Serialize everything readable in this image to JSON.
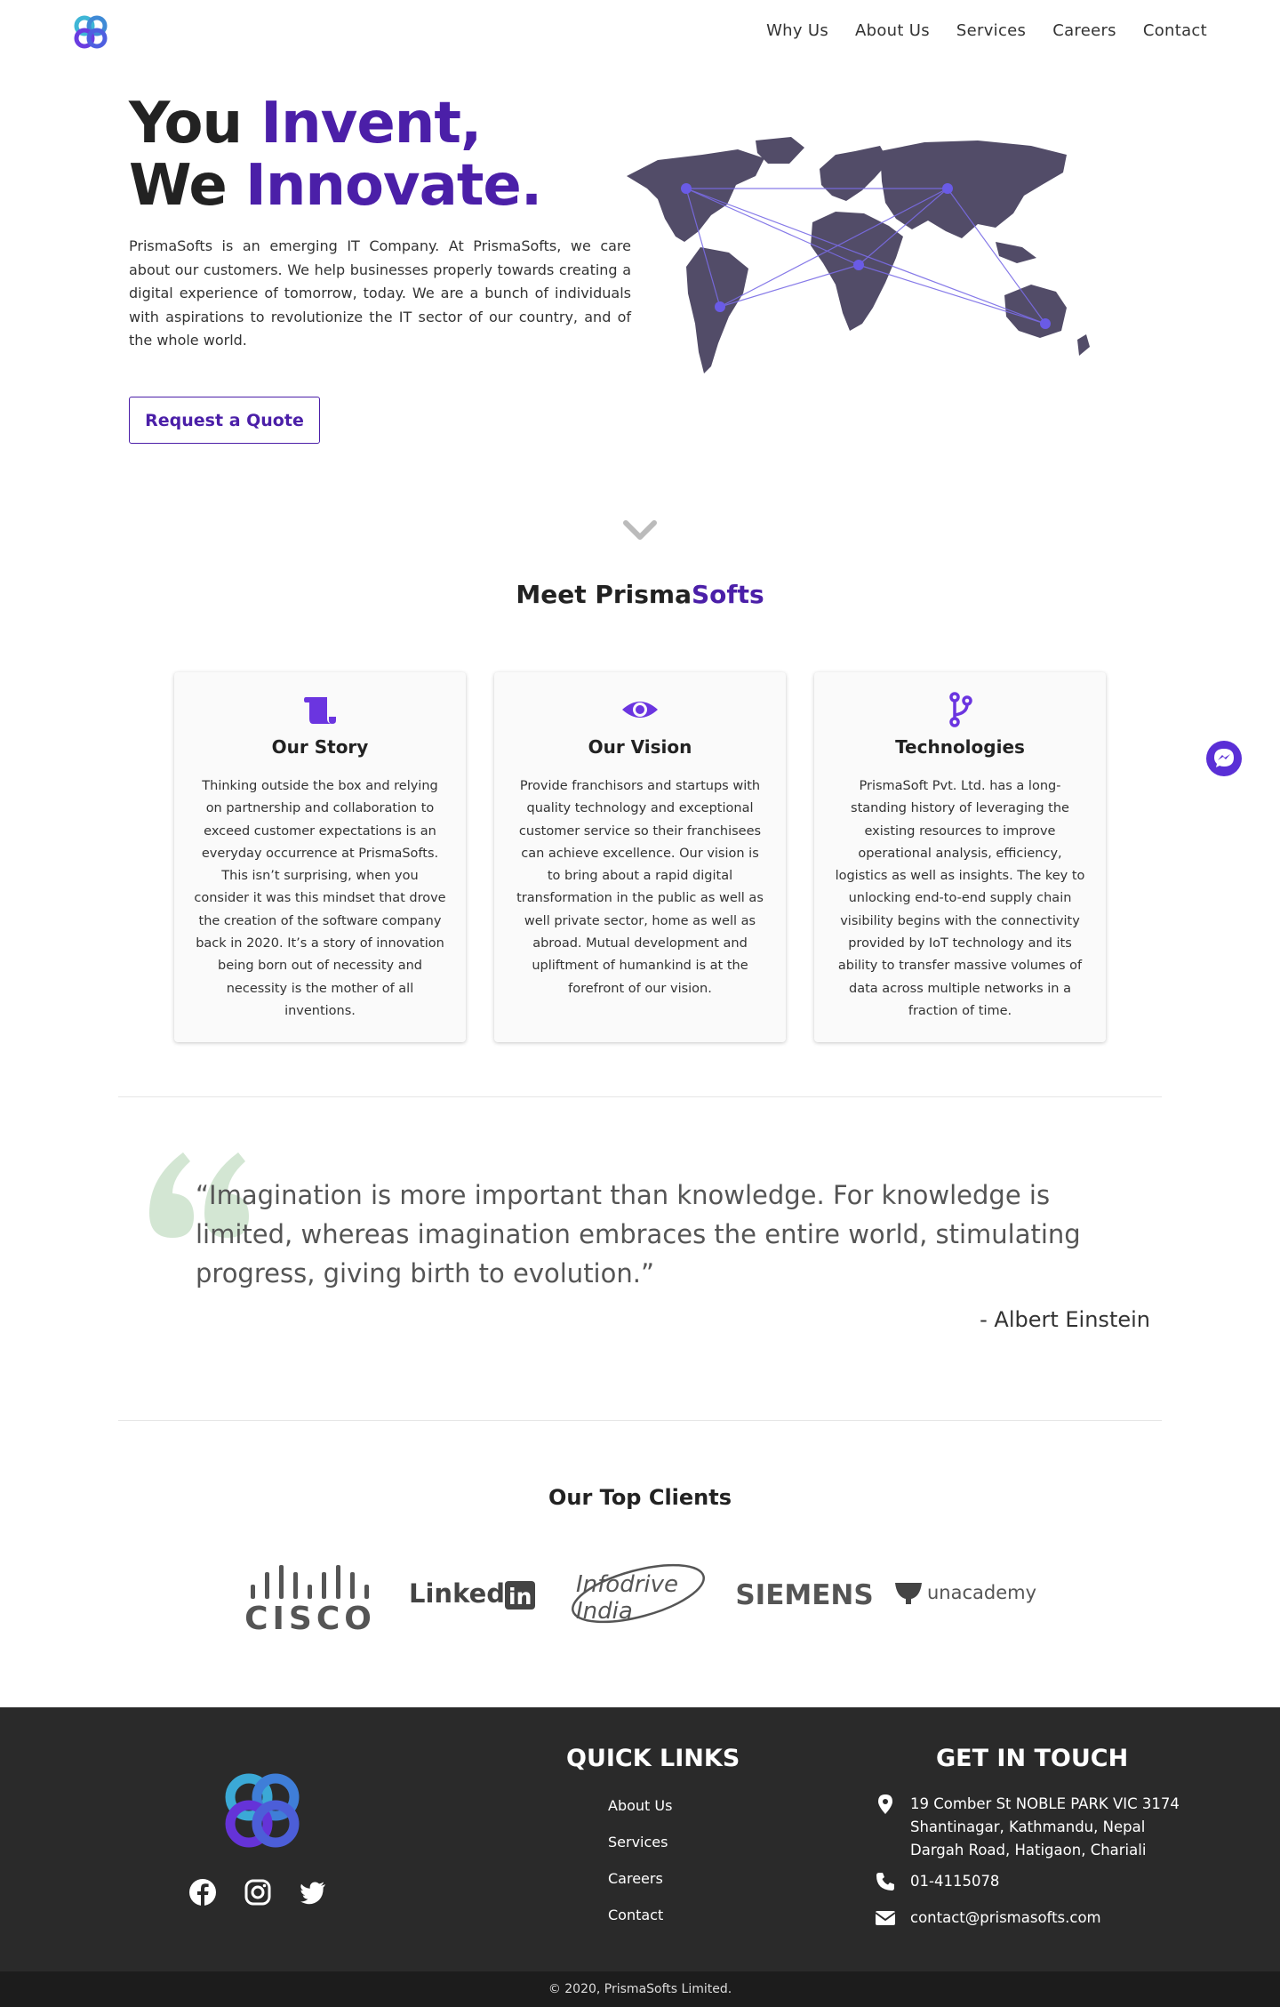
{
  "nav": {
    "links": [
      "Why Us",
      "About Us",
      "Services",
      "Careers",
      "Contact"
    ]
  },
  "hero": {
    "line1_plain": "You ",
    "line1_accent": "Invent,",
    "line2_plain": "We ",
    "line2_accent": "Innovate.",
    "text": "PrismaSofts is an emerging IT Company. At PrismaSofts, we care about our customers. We help businesses properly towards creating a digital experience of tomorrow, today. We are a bunch of individuals with aspirations to revolutionize the IT sector of our country, and of the whole world.",
    "cta": "Request a Quote"
  },
  "meet": {
    "plain": "Meet Prisma",
    "accent": "Softs"
  },
  "cards": [
    {
      "icon": "scroll-icon",
      "title": "Our Story",
      "text": "Thinking outside the box and relying on partnership and collaboration to exceed customer expectations is an everyday occurrence at PrismaSofts. This isn’t surprising, when you consider it was this mindset that drove the creation of the software company back in 2020. It’s a story of innovation being born out of necessity and necessity is the mother of all inventions."
    },
    {
      "icon": "eye-icon",
      "title": "Our Vision",
      "text": "Provide franchisors and startups with quality technology and exceptional customer service so their franchisees can achieve excellence. Our vision is to bring about a rapid digital transformation in the public as well as well private sector, home as well as abroad. Mutual development and upliftment of humankind is at the forefront of our vision."
    },
    {
      "icon": "code-branch-icon",
      "title": "Technologies",
      "text": "PrismaSoft Pvt. Ltd. has a long-standing history of leveraging the existing resources to improve operational analysis, efficiency, logistics as well as insights. The key to unlocking end-to-end supply chain visibility begins with the connectivity provided by IoT technology and its ability to transfer massive volumes of data across multiple networks in a fraction of time."
    }
  ],
  "quote": {
    "text": "“Imagination is more important than knowledge. For knowledge is limited, whereas imagination embraces the entire world, stimulating progress, giving birth to evolution.”",
    "author": "- Albert Einstein"
  },
  "clients": {
    "title": "Our Top Clients",
    "logos": [
      "CISCO",
      "LinkedIn",
      "Infodrive India",
      "SIEMENS",
      "unacademy"
    ]
  },
  "footer": {
    "quick_links_title": "QUICK LINKS",
    "quick_links": [
      "About Us",
      "Services",
      "Careers",
      "Contact"
    ],
    "contact_title": "GET IN TOUCH",
    "address": [
      "19 Comber St NOBLE PARK VIC 3174",
      "Shantinagar, Kathmandu, Nepal",
      "Dargah Road, Hatigaon, Chariali"
    ],
    "phone": "01-4115078",
    "email": "contact@prismasofts.com",
    "copyright": "© 2020, PrismaSofts Limited."
  },
  "colors": {
    "accent": "#4b1fa8",
    "icon_purple": "#6b35e0",
    "footer_bg": "#2a2a2a",
    "quote_mark": "#d3e6d3"
  }
}
